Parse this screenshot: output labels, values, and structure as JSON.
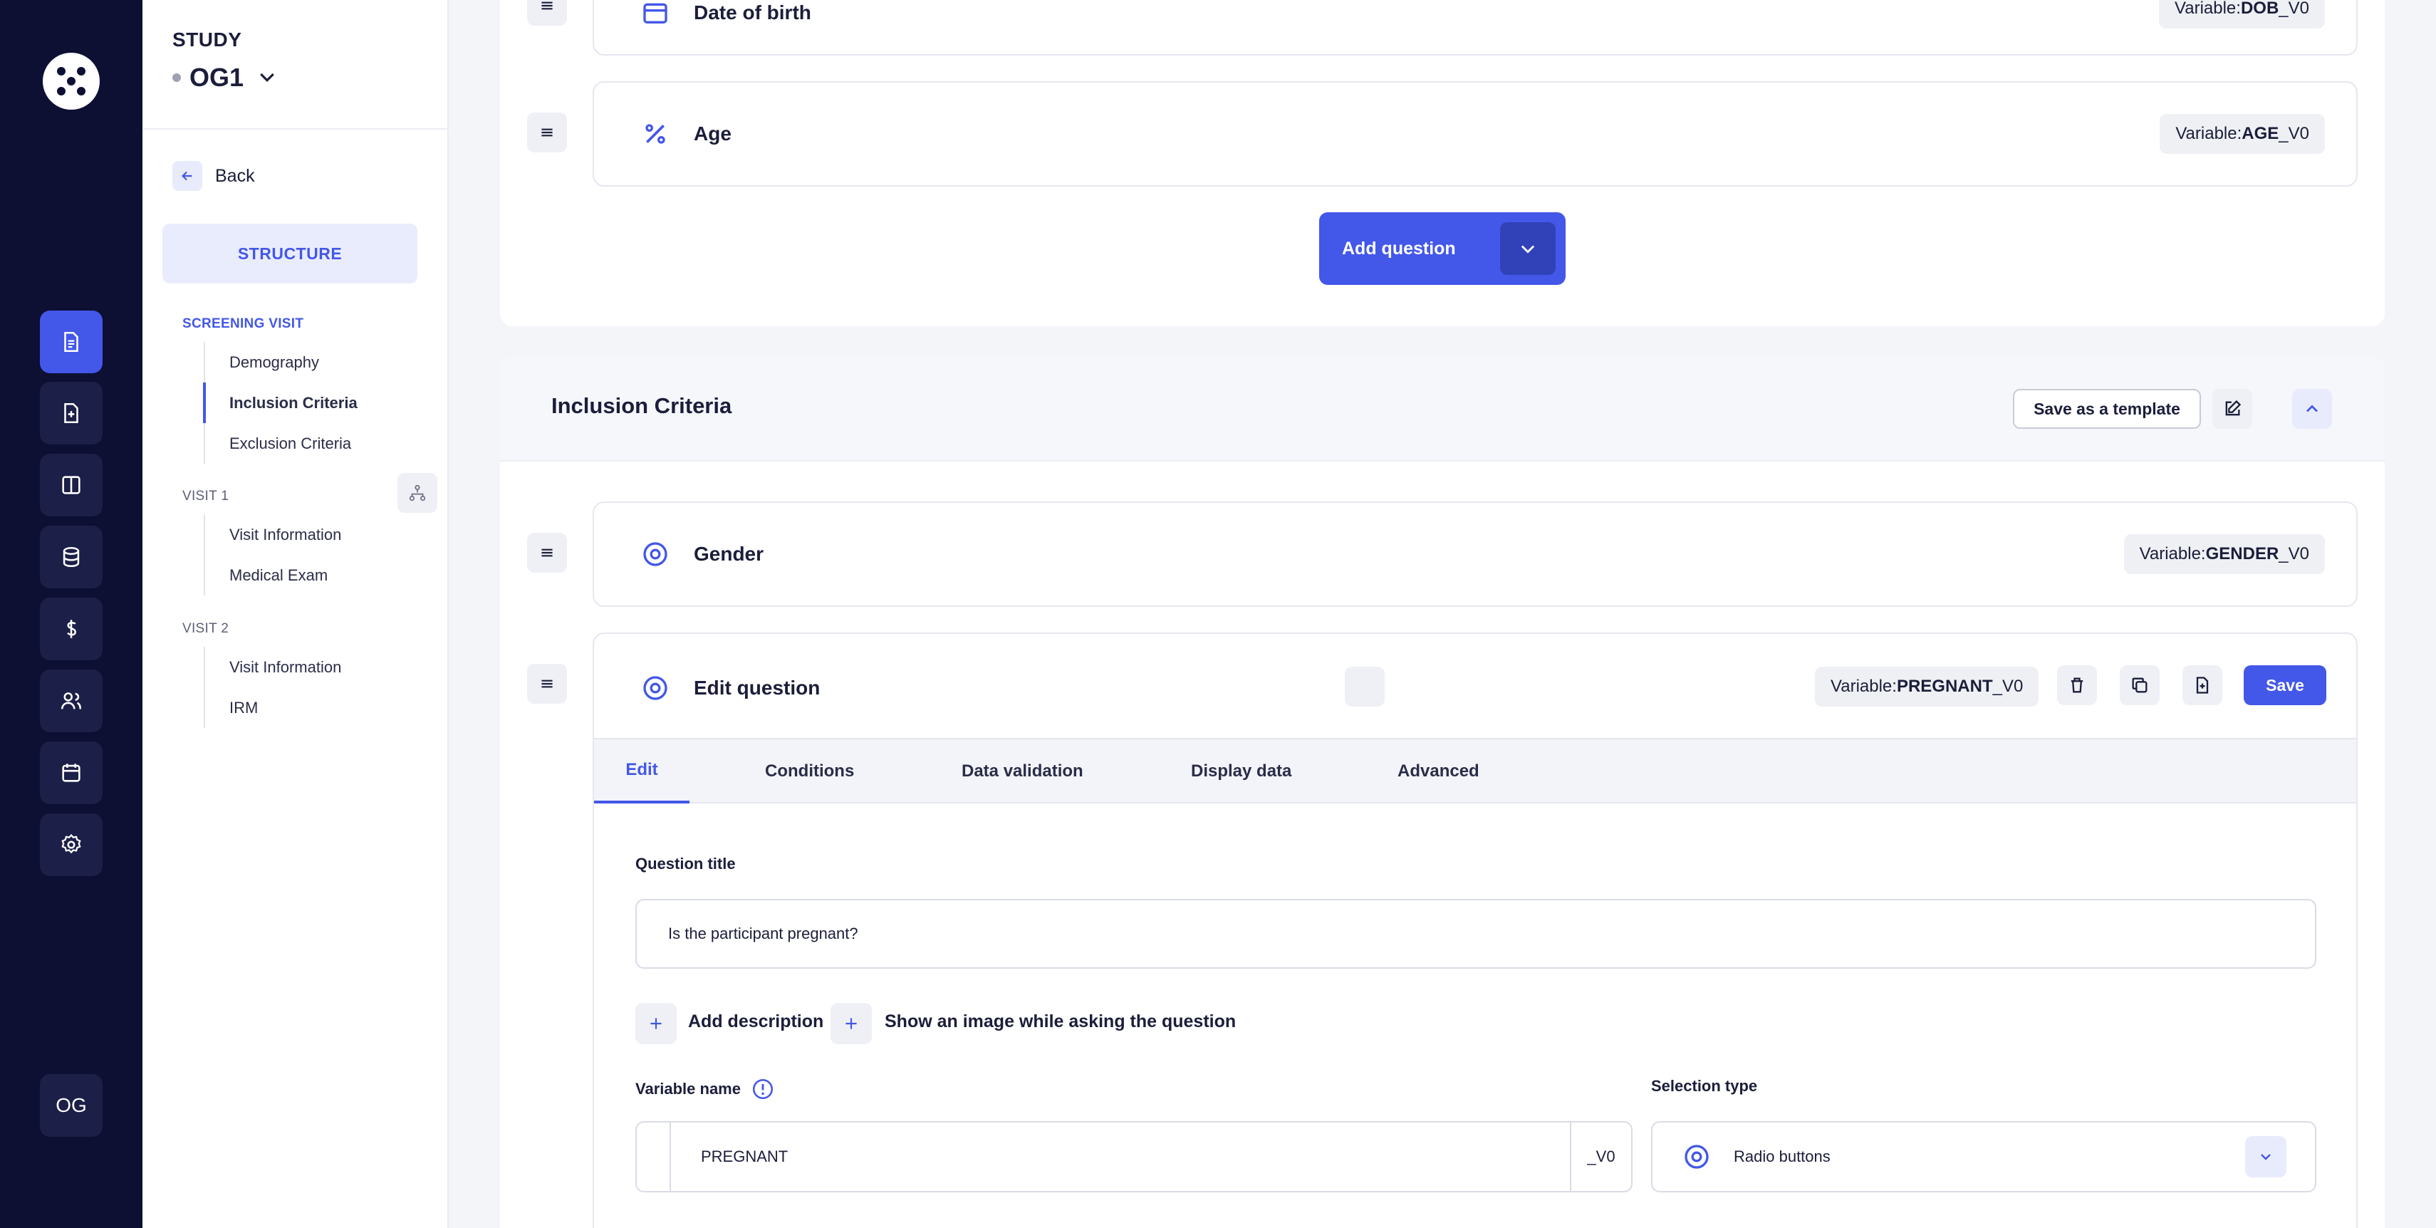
{
  "study": {
    "label": "STUDY",
    "name": "OG1"
  },
  "sidebar": {
    "back": "Back",
    "structure": "STRUCTURE",
    "visits": [
      {
        "label": "SCREENING VISIT",
        "items": [
          "Demography",
          "Inclusion Criteria",
          "Exclusion Criteria"
        ],
        "active": 1
      },
      {
        "label": "VISIT 1",
        "items": [
          "Visit Information",
          "Medical Exam"
        ]
      },
      {
        "label": "VISIT 2",
        "items": [
          "Visit Information",
          "IRM"
        ]
      }
    ]
  },
  "rail": {
    "avatar": "OG"
  },
  "prev_section": {
    "dob": {
      "title": "Date of birth",
      "variable_prefix": "Variable: ",
      "variable_bold": "DOB",
      "variable_suffix": "_V0"
    },
    "age": {
      "title": "Age",
      "variable_prefix": "Variable: ",
      "variable_bold": "AGE",
      "variable_suffix": "_V0"
    },
    "add_question": "Add question"
  },
  "section": {
    "title": "Inclusion Criteria",
    "save_template": "Save as a template",
    "gender": {
      "title": "Gender",
      "variable_prefix": "Variable: ",
      "variable_bold": "GENDER",
      "variable_suffix": "_V0"
    },
    "edit": {
      "title": "Edit question",
      "variable_prefix": "Variable: ",
      "variable_bold": "PREGNANT",
      "variable_suffix": "_V0",
      "save": "Save",
      "tabs": [
        "Edit",
        "Conditions",
        "Data validation",
        "Display data",
        "Advanced"
      ],
      "question_title_label": "Question title",
      "question_title_value": "Is the participant pregnant?",
      "add_description": "Add description",
      "show_image": "Show an image while asking the question",
      "variable_name_label": "Variable name",
      "variable_name_value": "PREGNANT",
      "variable_suffix_value": "_V0",
      "selection_type_label": "Selection type",
      "selection_type_value": "Radio buttons"
    }
  },
  "colors": {
    "accent": "#4357e8",
    "rail": "#0d0f33"
  }
}
